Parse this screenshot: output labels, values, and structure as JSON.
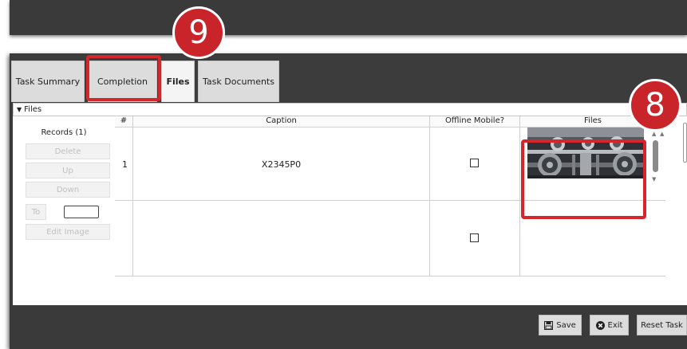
{
  "tabs": {
    "task_summary": "Task Summary",
    "completion": "Completion",
    "files": "Files",
    "task_documents": "Task Documents"
  },
  "section": {
    "title": "Files"
  },
  "records": {
    "title": "Records (1)",
    "delete": "Delete",
    "up": "Up",
    "down": "Down",
    "to": "To",
    "to_value": "",
    "edit_image": "Edit Image"
  },
  "grid": {
    "headers": [
      "#",
      "Caption",
      "Offline Mobile?",
      "Files"
    ],
    "rows": [
      {
        "num": "1",
        "caption": "X2345P0",
        "offline_mobile": false,
        "has_image": true
      },
      {
        "num": "",
        "caption": "",
        "offline_mobile": false,
        "has_image": false
      }
    ]
  },
  "footer": {
    "save": "Save",
    "exit": "Exit",
    "reset_task": "Reset Task"
  },
  "callouts": {
    "files_image": "8",
    "completion_tab": "9"
  },
  "colors": {
    "callout": "#d7262b",
    "dark_bg": "#3a3a3a"
  },
  "icons": {
    "save": "floppy-disk-icon",
    "exit": "close-circle-icon",
    "section_toggle": "caret-down-icon"
  }
}
